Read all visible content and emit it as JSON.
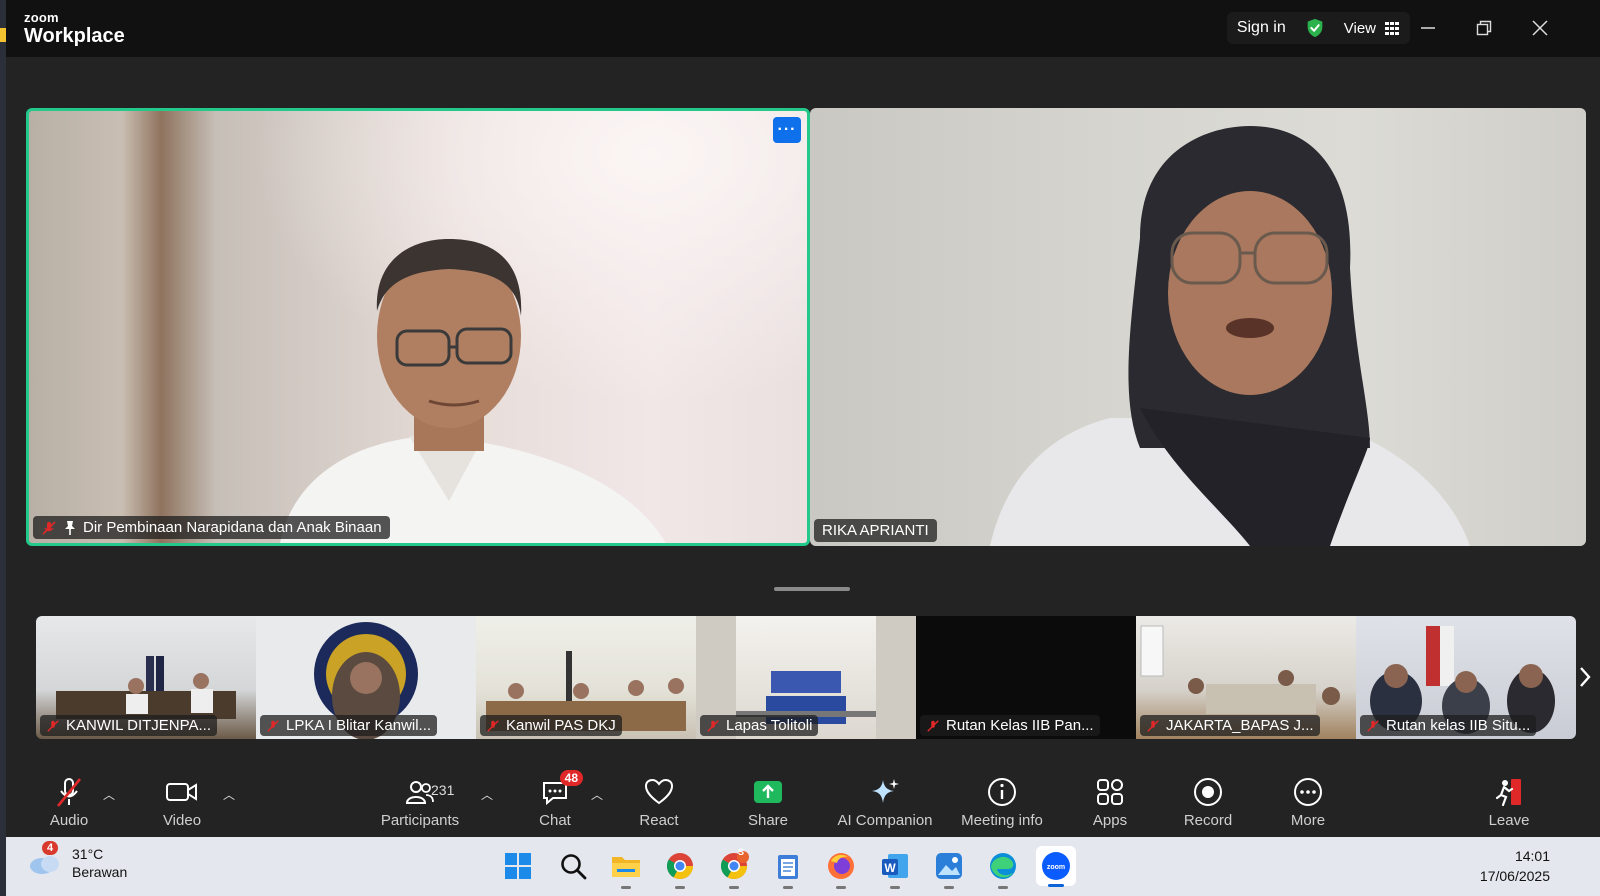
{
  "titlebar": {
    "logo_small": "zoom",
    "logo_main": "Workplace",
    "signin": "Sign in",
    "view": "View"
  },
  "main_tiles": [
    {
      "name": "Dir Pembinaan Narapidana dan Anak Binaan",
      "muted": true,
      "pinned": true,
      "active_speaker": true
    },
    {
      "name": "RIKA APRIANTI",
      "muted": false
    }
  ],
  "more_options": "···",
  "gallery": [
    {
      "name": "KANWIL DITJENPA..."
    },
    {
      "name": "LPKA I Blitar Kanwil..."
    },
    {
      "name": "Kanwil PAS DKJ"
    },
    {
      "name": "Lapas Tolitoli"
    },
    {
      "name": "Rutan Kelas IIB Pan..."
    },
    {
      "name": "JAKARTA_BAPAS J..."
    },
    {
      "name": "Rutan kelas IIB Situ..."
    }
  ],
  "toolbar": {
    "audio": "Audio",
    "video": "Video",
    "participants": "Participants",
    "participants_count": "231",
    "chat": "Chat",
    "chat_badge": "48",
    "react": "React",
    "share": "Share",
    "ai_companion": "AI Companion",
    "meeting_info": "Meeting info",
    "apps": "Apps",
    "record": "Record",
    "more": "More",
    "leave": "Leave"
  },
  "taskbar": {
    "weather_temp": "31°C",
    "weather_desc": "Berawan",
    "weather_badge": "4",
    "chrome2_badge": "S",
    "time": "14:01",
    "date": "17/06/2025",
    "apps": [
      "windows-start",
      "search",
      "file-explorer",
      "chrome",
      "chrome-profile",
      "notepad",
      "firefox",
      "word",
      "photos",
      "edge",
      "zoom"
    ]
  },
  "colors": {
    "active_speaker_border": "#22c98a",
    "share_green": "#1fb85c",
    "leave_red": "#e02828",
    "accent_blue": "#0e71eb"
  }
}
